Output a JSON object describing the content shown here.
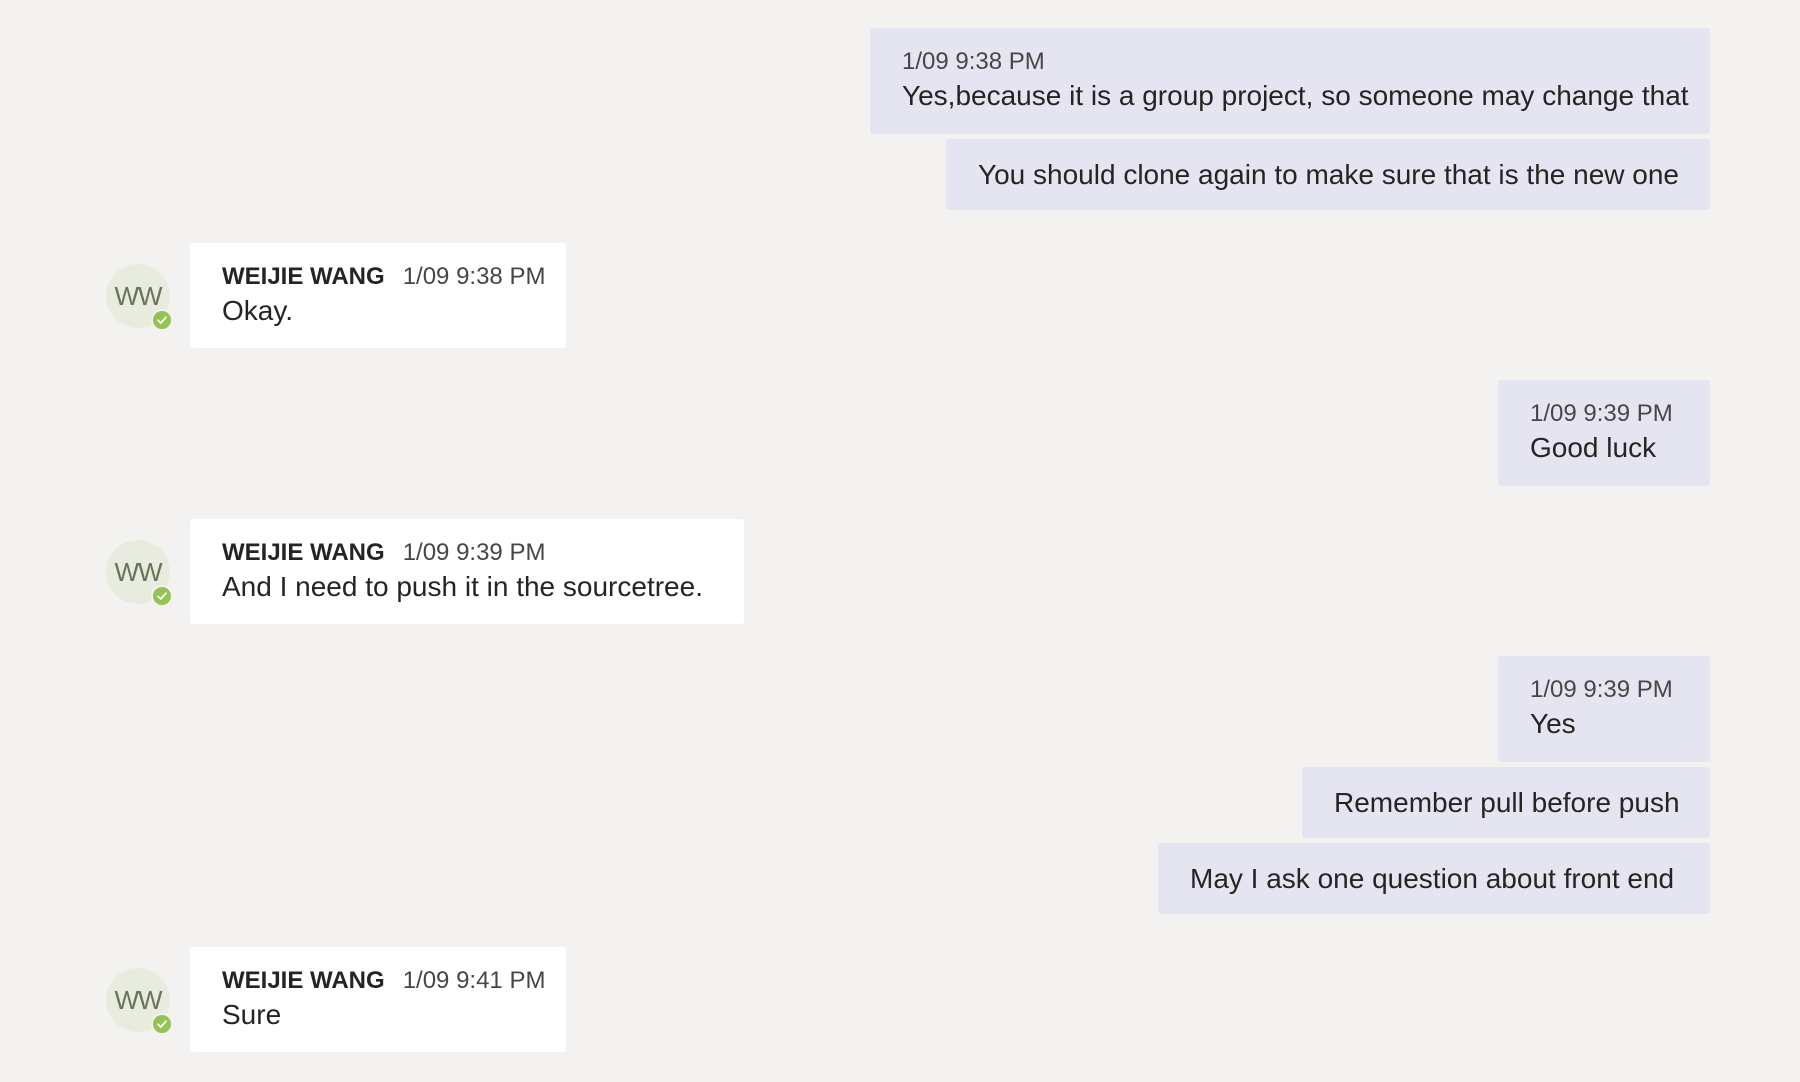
{
  "colors": {
    "background": "#f3f2f1",
    "sent_bubble": "#e5e5f1",
    "received_bubble": "#ffffff",
    "presence_available": "#92c353"
  },
  "contact": {
    "name": "WEIJIE WANG",
    "initials": "WW",
    "presence_icon": "check-icon"
  },
  "messages": [
    {
      "direction": "sent",
      "time": "1/09 9:38 PM",
      "text": "Yes,because it is a group project, so someone may change that"
    },
    {
      "direction": "sent",
      "time": "",
      "text": "You should clone again to make sure that is the new one"
    },
    {
      "direction": "received",
      "sender": "WEIJIE WANG",
      "time": "1/09 9:38 PM",
      "text": "Okay."
    },
    {
      "direction": "sent",
      "time": "1/09 9:39 PM",
      "text": "Good luck"
    },
    {
      "direction": "received",
      "sender": "WEIJIE WANG",
      "time": "1/09 9:39 PM",
      "text": "And I need to push it in the sourcetree."
    },
    {
      "direction": "sent",
      "time": "1/09 9:39 PM",
      "text": "Yes"
    },
    {
      "direction": "sent",
      "time": "",
      "text": "Remember pull before push"
    },
    {
      "direction": "sent",
      "time": "",
      "text": "May I ask one question about front end"
    },
    {
      "direction": "received",
      "sender": "WEIJIE WANG",
      "time": "1/09 9:41 PM",
      "text": "Sure"
    }
  ]
}
